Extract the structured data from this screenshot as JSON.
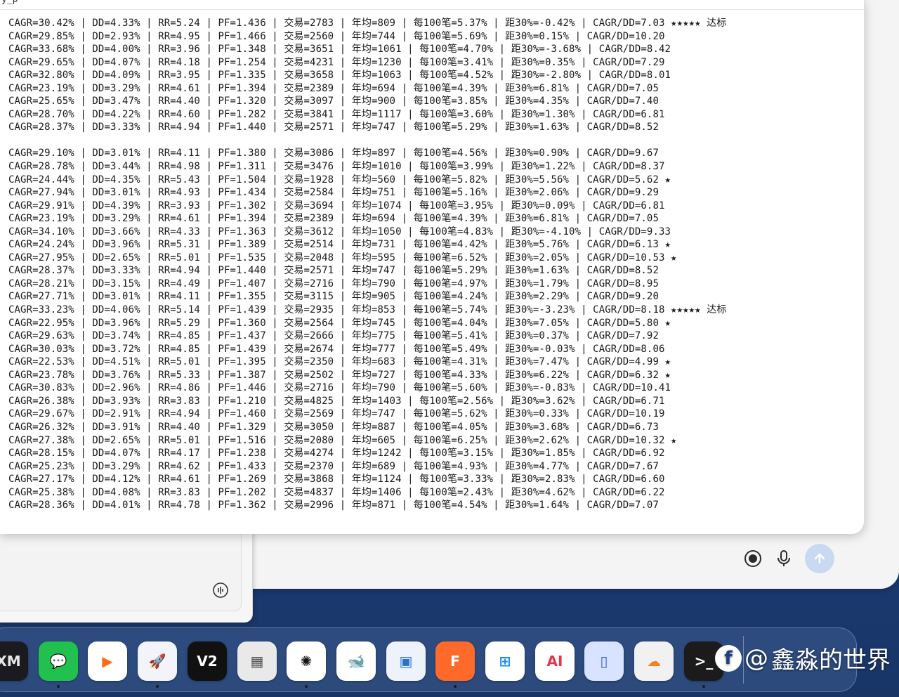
{
  "terminal": {
    "header_fragment": "y_p",
    "lines_group1": [
      "CAGR=30.42% | DD=4.33% | RR=5.24 | PF=1.436 | 交易=2783 | 年均=809 | 每100笔=5.37% | 距30%=-0.42% | CAGR/DD=7.03 ★★★★★ 达标",
      "CAGR=29.85% | DD=2.93% | RR=4.95 | PF=1.466 | 交易=2560 | 年均=744 | 每100笔=5.69% | 距30%=0.15% | CAGR/DD=10.20",
      "CAGR=33.68% | DD=4.00% | RR=3.96 | PF=1.348 | 交易=3651 | 年均=1061 | 每100笔=4.70% | 距30%=-3.68% | CAGR/DD=8.42",
      "CAGR=29.65% | DD=4.07% | RR=4.18 | PF=1.254 | 交易=4231 | 年均=1230 | 每100笔=3.41% | 距30%=0.35% | CAGR/DD=7.29",
      "CAGR=32.80% | DD=4.09% | RR=3.95 | PF=1.335 | 交易=3658 | 年均=1063 | 每100笔=4.52% | 距30%=-2.80% | CAGR/DD=8.01",
      "CAGR=23.19% | DD=3.29% | RR=4.61 | PF=1.394 | 交易=2389 | 年均=694 | 每100笔=4.39% | 距30%=6.81% | CAGR/DD=7.05",
      "CAGR=25.65% | DD=3.47% | RR=4.40 | PF=1.320 | 交易=3097 | 年均=900 | 每100笔=3.85% | 距30%=4.35% | CAGR/DD=7.40",
      "CAGR=28.70% | DD=4.22% | RR=4.60 | PF=1.282 | 交易=3841 | 年均=1117 | 每100笔=3.60% | 距30%=1.30% | CAGR/DD=6.81",
      "CAGR=28.37% | DD=3.33% | RR=4.94 | PF=1.440 | 交易=2571 | 年均=747 | 每100笔=5.29% | 距30%=1.63% | CAGR/DD=8.52"
    ],
    "lines_group2": [
      "CAGR=29.10% | DD=3.01% | RR=4.11 | PF=1.380 | 交易=3086 | 年均=897 | 每100笔=4.56% | 距30%=0.90% | CAGR/DD=9.67",
      "CAGR=28.78% | DD=3.44% | RR=4.98 | PF=1.311 | 交易=3476 | 年均=1010 | 每100笔=3.99% | 距30%=1.22% | CAGR/DD=8.37",
      "CAGR=24.44% | DD=4.35% | RR=5.43 | PF=1.504 | 交易=1928 | 年均=560 | 每100笔=5.82% | 距30%=5.56% | CAGR/DD=5.62 ★",
      "CAGR=27.94% | DD=3.01% | RR=4.93 | PF=1.434 | 交易=2584 | 年均=751 | 每100笔=5.16% | 距30%=2.06% | CAGR/DD=9.29",
      "CAGR=29.91% | DD=4.39% | RR=3.93 | PF=1.302 | 交易=3694 | 年均=1074 | 每100笔=3.95% | 距30%=0.09% | CAGR/DD=6.81",
      "CAGR=23.19% | DD=3.29% | RR=4.61 | PF=1.394 | 交易=2389 | 年均=694 | 每100笔=4.39% | 距30%=6.81% | CAGR/DD=7.05",
      "CAGR=34.10% | DD=3.66% | RR=4.33 | PF=1.363 | 交易=3612 | 年均=1050 | 每100笔=4.83% | 距30%=-4.10% | CAGR/DD=9.33",
      "CAGR=24.24% | DD=3.96% | RR=5.31 | PF=1.389 | 交易=2514 | 年均=731 | 每100笔=4.42% | 距30%=5.76% | CAGR/DD=6.13 ★",
      "CAGR=27.95% | DD=2.65% | RR=5.01 | PF=1.535 | 交易=2048 | 年均=595 | 每100笔=6.52% | 距30%=2.05% | CAGR/DD=10.53 ★",
      "CAGR=28.37% | DD=3.33% | RR=4.94 | PF=1.440 | 交易=2571 | 年均=747 | 每100笔=5.29% | 距30%=1.63% | CAGR/DD=8.52",
      "CAGR=28.21% | DD=3.15% | RR=4.49 | PF=1.407 | 交易=2716 | 年均=790 | 每100笔=4.97% | 距30%=1.79% | CAGR/DD=8.95",
      "CAGR=27.71% | DD=3.01% | RR=4.11 | PF=1.355 | 交易=3115 | 年均=905 | 每100笔=4.24% | 距30%=2.29% | CAGR/DD=9.20",
      "CAGR=33.23% | DD=4.06% | RR=5.14 | PF=1.439 | 交易=2935 | 年均=853 | 每100笔=5.74% | 距30%=-3.23% | CAGR/DD=8.18 ★★★★★ 达标",
      "CAGR=22.95% | DD=3.96% | RR=5.29 | PF=1.360 | 交易=2564 | 年均=745 | 每100笔=4.04% | 距30%=7.05% | CAGR/DD=5.80 ★",
      "CAGR=29.63% | DD=3.74% | RR=4.85 | PF=1.437 | 交易=2666 | 年均=775 | 每100笔=5.41% | 距30%=0.37% | CAGR/DD=7.92",
      "CAGR=30.03% | DD=3.72% | RR=4.85 | PF=1.439 | 交易=2674 | 年均=777 | 每100笔=5.49% | 距30%=-0.03% | CAGR/DD=8.06",
      "CAGR=22.53% | DD=4.51% | RR=5.01 | PF=1.395 | 交易=2350 | 年均=683 | 每100笔=4.31% | 距30%=7.47% | CAGR/DD=4.99 ★",
      "CAGR=23.78% | DD=3.76% | RR=5.33 | PF=1.387 | 交易=2502 | 年均=727 | 每100笔=4.33% | 距30%=6.22% | CAGR/DD=6.32 ★",
      "CAGR=30.83% | DD=2.96% | RR=4.86 | PF=1.446 | 交易=2716 | 年均=790 | 每100笔=5.60% | 距30%=-0.83% | CAGR/DD=10.41",
      "CAGR=26.38% | DD=3.93% | RR=3.83 | PF=1.210 | 交易=4825 | 年均=1403 | 每100笔=2.56% | 距30%=3.62% | CAGR/DD=6.71",
      "CAGR=29.67% | DD=2.91% | RR=4.94 | PF=1.460 | 交易=2569 | 年均=747 | 每100笔=5.62% | 距30%=0.33% | CAGR/DD=10.19",
      "CAGR=26.32% | DD=3.91% | RR=4.40 | PF=1.329 | 交易=3050 | 年均=887 | 每100笔=4.05% | 距30%=3.68% | CAGR/DD=6.73",
      "CAGR=27.38% | DD=2.65% | RR=5.01 | PF=1.516 | 交易=2080 | 年均=605 | 每100笔=6.25% | 距30%=2.62% | CAGR/DD=10.32 ★",
      "CAGR=28.15% | DD=4.07% | RR=4.17 | PF=1.238 | 交易=4274 | 年均=1242 | 每100笔=3.15% | 距30%=1.85% | CAGR/DD=6.92",
      "CAGR=25.23% | DD=3.29% | RR=4.62 | PF=1.433 | 交易=2370 | 年均=689 | 每100笔=4.93% | 距30%=4.77% | CAGR/DD=7.67",
      "CAGR=27.17% | DD=4.12% | RR=4.61 | PF=1.269 | 交易=3868 | 年均=1124 | 每100笔=3.33% | 距30%=2.83% | CAGR/DD=6.60",
      "CAGR=25.38% | DD=4.08% | RR=3.83 | PF=1.202 | 交易=4837 | 年均=1406 | 每100笔=2.43% | 距30%=4.62% | CAGR/DD=6.22",
      "CAGR=28.36% | DD=4.01% | RR=4.78 | PF=1.362 | 交易=2996 | 年均=871 | 每100笔=4.54% | 距30%=1.64% | CAGR/DD=7.07"
    ]
  },
  "chat_bar": {
    "record_icon": "record-icon",
    "mic_icon": "microphone-icon",
    "send_icon": "arrow-up-icon",
    "send_color": "#c9d9f1"
  },
  "dock": {
    "apps": [
      {
        "name": "xm",
        "label": "XM",
        "bg": "#1b1b1f",
        "fg": "#e8e8e8",
        "running": false
      },
      {
        "name": "wechat",
        "label": "💬",
        "bg": "#22c04f",
        "fg": "#ffffff",
        "running": true
      },
      {
        "name": "infuse-player",
        "label": "▶",
        "bg": "#ffffff",
        "fg": "#ff6a13",
        "running": false
      },
      {
        "name": "rocket",
        "label": "🚀",
        "bg": "#f2f4fa",
        "fg": "#5a6ad8",
        "running": true
      },
      {
        "name": "v2box",
        "label": "V2",
        "bg": "#111111",
        "fg": "#ffffff",
        "running": false
      },
      {
        "name": "package-box",
        "label": "▦",
        "bg": "#e9e9ea",
        "fg": "#555555",
        "running": false
      },
      {
        "name": "chatgpt",
        "label": "✺",
        "bg": "#ffffff",
        "fg": "#111111",
        "running": true
      },
      {
        "name": "deepseek",
        "label": "🐋",
        "bg": "#ffffff",
        "fg": "#4d6bfe",
        "running": false
      },
      {
        "name": "screen-capture",
        "label": "▣",
        "bg": "#eef3fb",
        "fg": "#2a6fd8",
        "running": false
      },
      {
        "name": "feishu-f",
        "label": "F",
        "bg": "#ff6a2a",
        "fg": "#ffffff",
        "running": true
      },
      {
        "name": "windows-app",
        "label": "⊞",
        "bg": "#ffffff",
        "fg": "#1a8ce6",
        "running": false
      },
      {
        "name": "ai-terminal",
        "label": "AI",
        "bg": "#ffffff",
        "fg": "#e5334b",
        "running": false
      },
      {
        "name": "iphone-mirror",
        "label": "▯",
        "bg": "#d8e4ff",
        "fg": "#3c5bd8",
        "running": false
      },
      {
        "name": "cloudflare",
        "label": "☁",
        "bg": "#f1f1f2",
        "fg": "#f48120",
        "running": false
      },
      {
        "name": "terminal",
        "label": ">_",
        "bg": "#1b1b1b",
        "fg": "#ffffff",
        "running": true
      }
    ]
  },
  "watermark": {
    "at": "@",
    "text": "鑫淼的世界",
    "logo_glyph": "f"
  }
}
